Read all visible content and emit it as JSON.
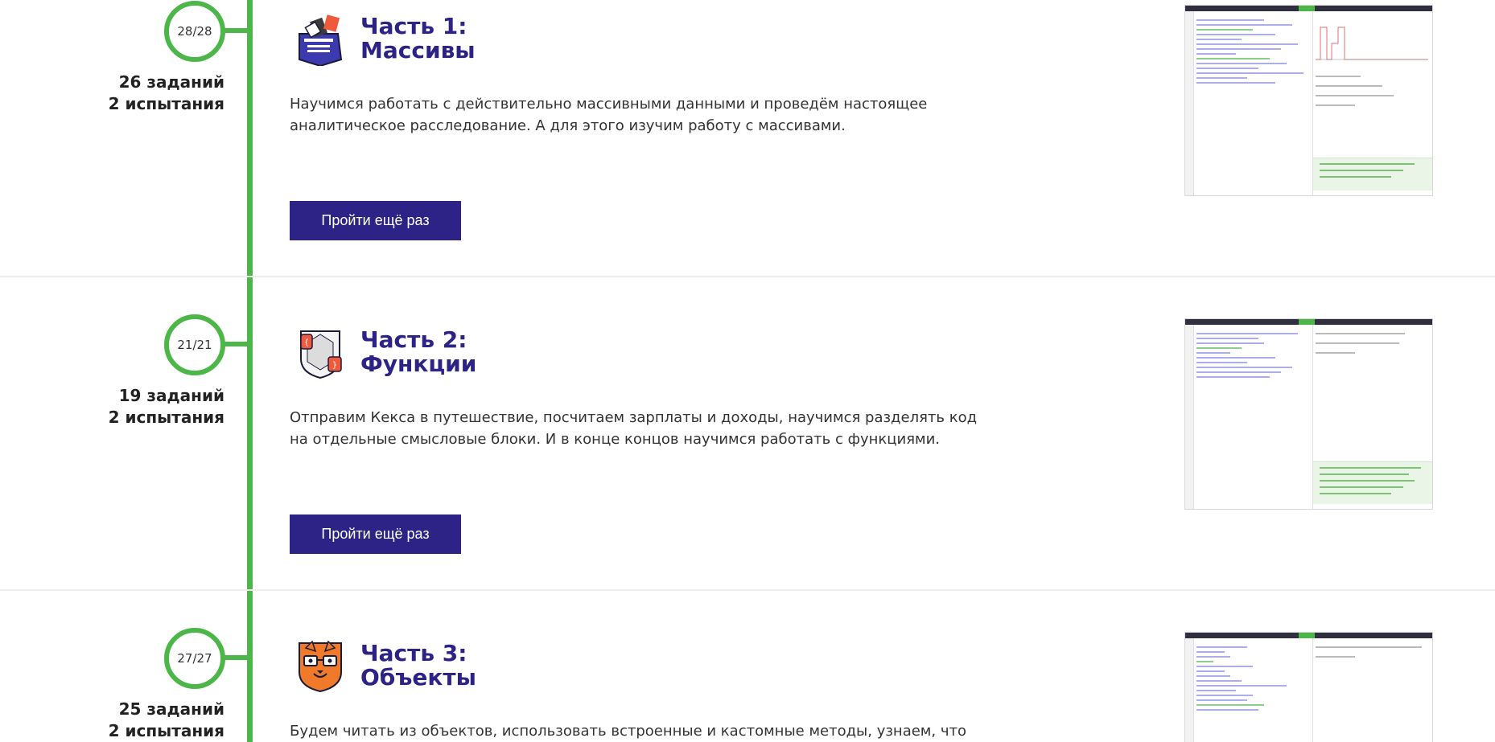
{
  "colors": {
    "timeline_green": "#4cb648",
    "title_purple": "#2d2387",
    "button_bg": "#2d2387",
    "button_text": "#ffffff",
    "body_text": "#333333"
  },
  "sections": [
    {
      "progress": "28/28",
      "tasks": "26 заданий",
      "trials": "2 испытания",
      "title_line1": "Часть 1:",
      "title_line2": "Массивы",
      "icon": "box-with-cards-icon",
      "description": "Научимся работать с действительно массивными данными и проведём настоящее аналитическое расследование. А для этого изучим работу с массивами.",
      "button_label": "Пройти ещё раз",
      "preview": "code-editor-preview-arrays"
    },
    {
      "progress": "21/21",
      "tasks": "19 заданий",
      "trials": "2 испытания",
      "title_line1": "Часть 2:",
      "title_line2": "Функции",
      "icon": "fist-with-braces-icon",
      "description": "Отправим Кекса в путешествие, посчитаем зарплаты и доходы, научимся разделять код на отдельные смысловые блоки. И в конце концов научимся работать с функциями.",
      "button_label": "Пройти ещё раз",
      "preview": "code-editor-preview-functions"
    },
    {
      "progress": "27/27",
      "tasks": "25 заданий",
      "trials": "2 испытания",
      "title_line1": "Часть 3:",
      "title_line2": "Объекты",
      "icon": "cat-with-glasses-icon",
      "description": "Будем читать из объектов, использовать встроенные и кастомные методы, узнаем, что такое",
      "preview": "code-editor-preview-objects"
    }
  ]
}
